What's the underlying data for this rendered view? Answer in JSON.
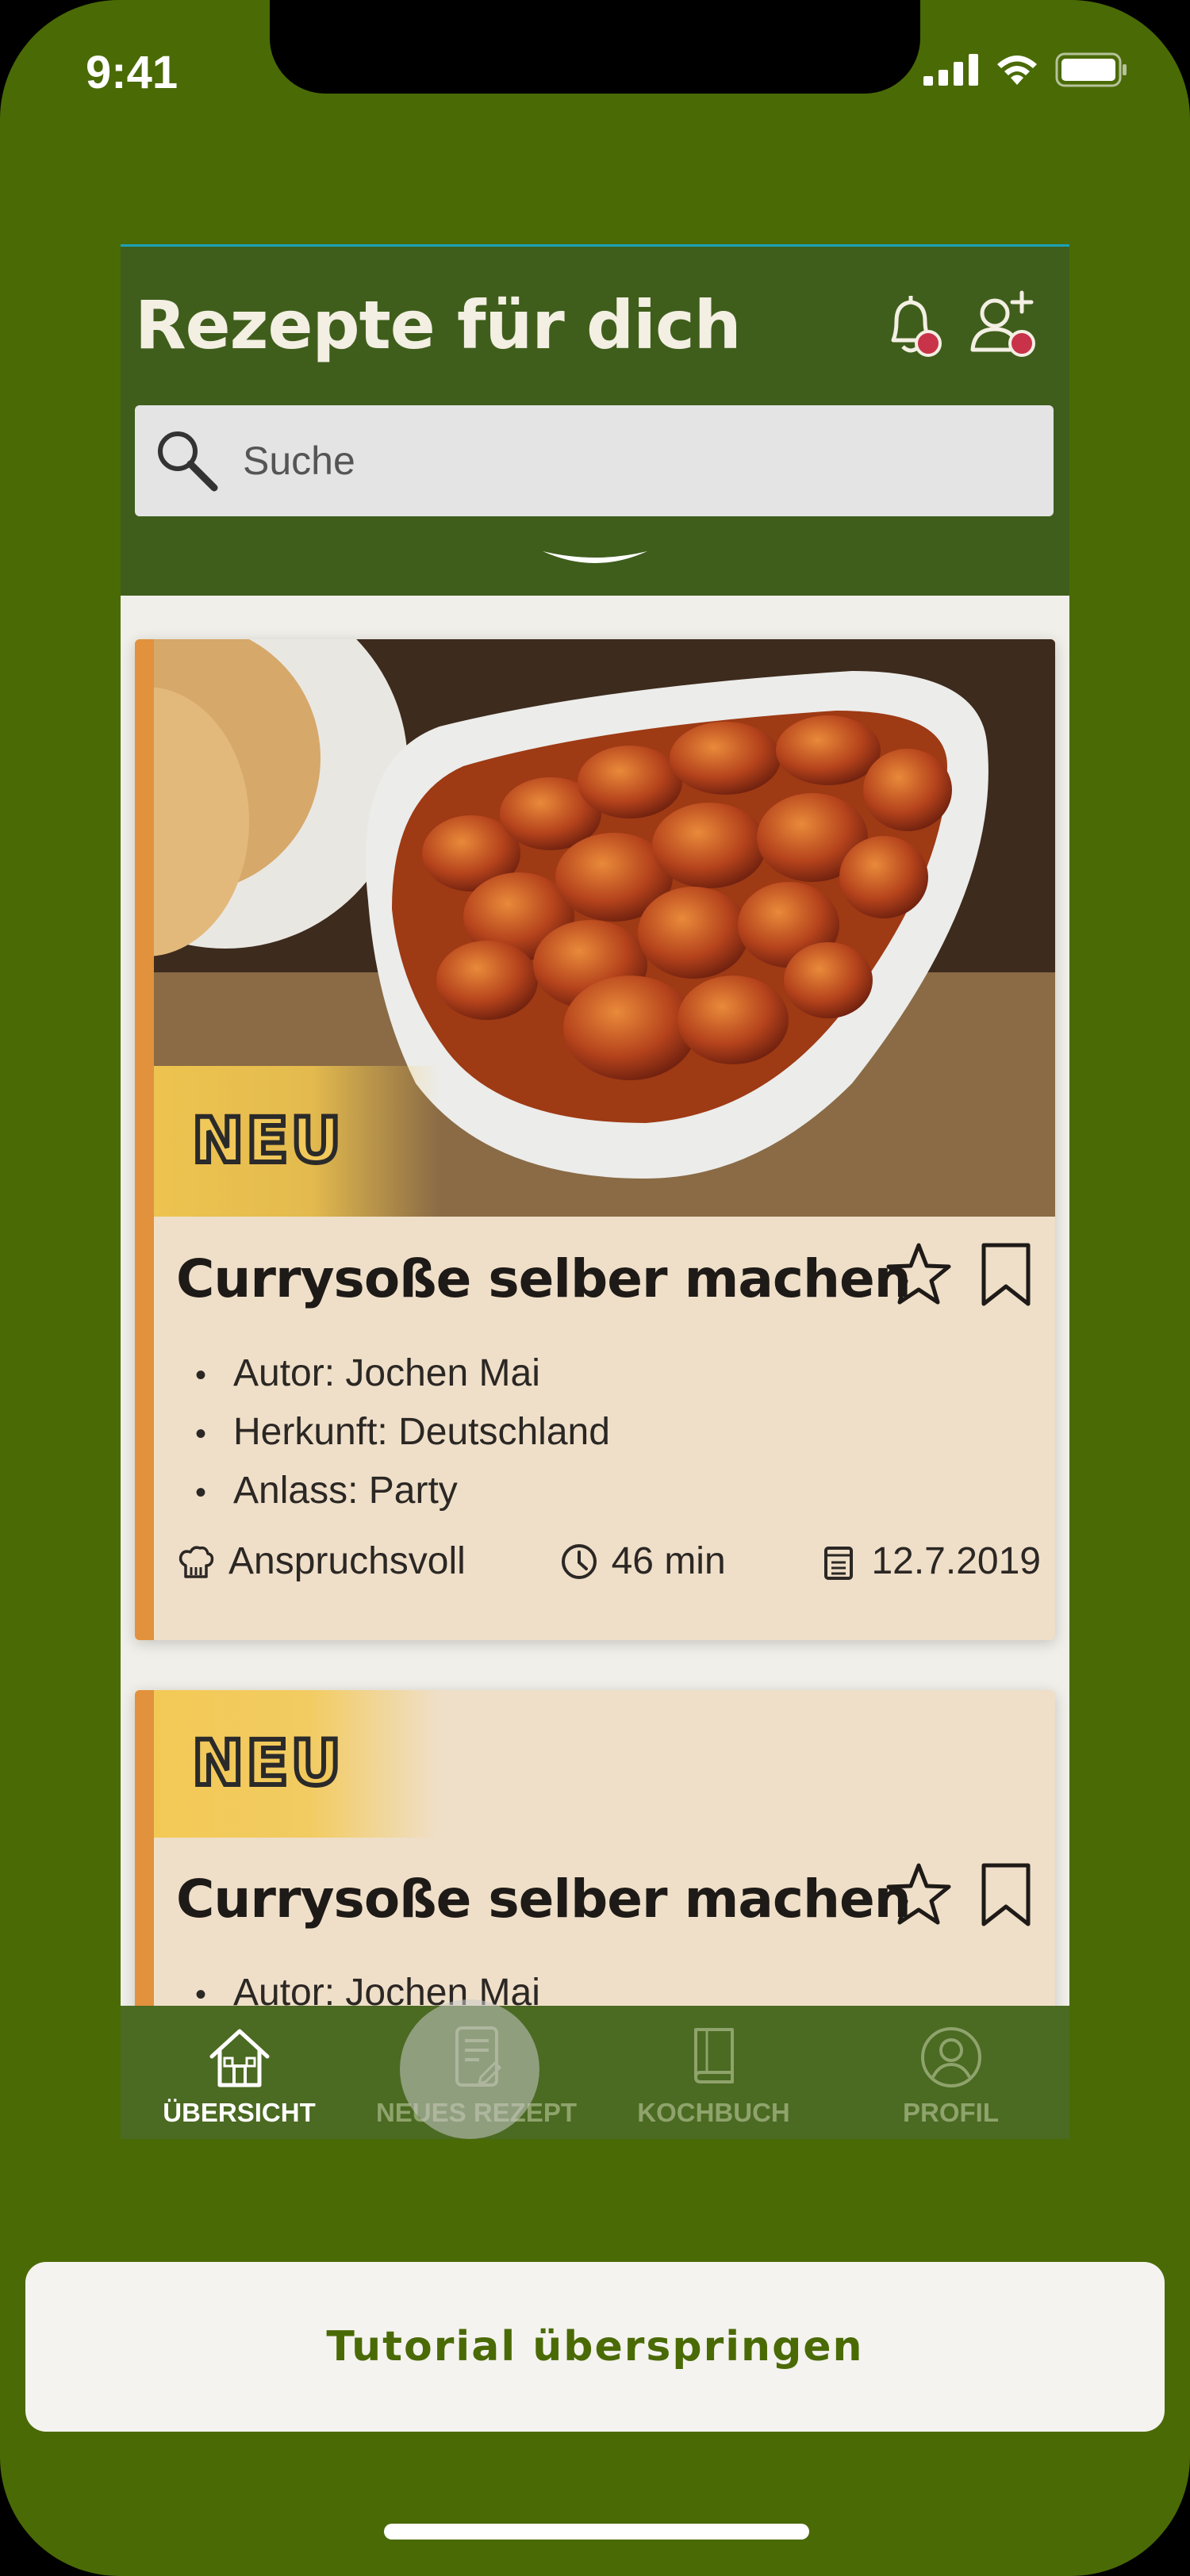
{
  "status_bar": {
    "time": "9:41"
  },
  "header": {
    "title": "Rezepte für dich",
    "search_placeholder": "Suche"
  },
  "cards": [
    {
      "badge": "NEU",
      "title": "Currysoße selber machen",
      "details": [
        "Autor: Jochen Mai",
        "Herkunft: Deutschland",
        "Anlass: Party"
      ],
      "difficulty": "Anspruchsvoll",
      "duration": "46 min",
      "date": "12.7.2019"
    },
    {
      "badge": "NEU",
      "title": "Currysoße selber machen",
      "details": [
        "Autor: Jochen Mai"
      ]
    }
  ],
  "bottom_nav": [
    {
      "label": "ÜBERSICHT",
      "icon": "house-icon",
      "active": true
    },
    {
      "label": "NEUES REZEPT",
      "icon": "new-recipe-icon",
      "active": false
    },
    {
      "label": "KOCHBUCH",
      "icon": "book-icon",
      "active": false
    },
    {
      "label": "PROFIL",
      "icon": "profile-icon",
      "active": false
    }
  ],
  "tutorial": {
    "skip_label": "Tutorial überspringen"
  },
  "colors": {
    "background": "#4a6a06",
    "header": "#3f5e1c",
    "card": "#efdfc8",
    "card_accent": "#e2923c",
    "notification_dot": "#c8334a"
  }
}
